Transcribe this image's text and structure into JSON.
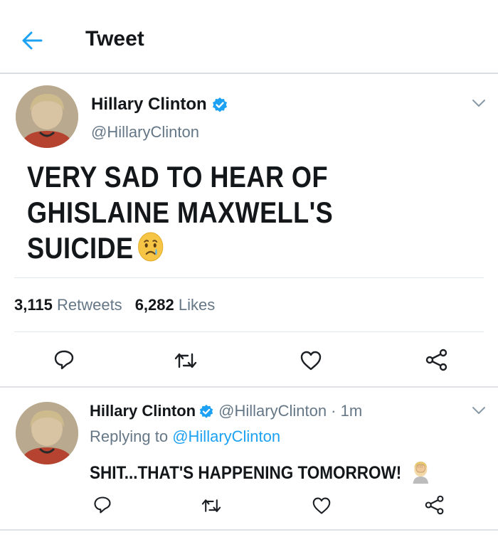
{
  "header": {
    "title": "Tweet"
  },
  "tweet": {
    "author_name": "Hillary Clinton",
    "author_handle": "@HillaryClinton",
    "text": "VERY SAD TO HEAR OF GHISLAINE MAXWELL'S SUICIDE",
    "retweet_count": "3,115",
    "retweet_label": "Retweets",
    "like_count": "6,282",
    "like_label": "Likes"
  },
  "reply": {
    "author_name": "Hillary Clinton",
    "author_handle_time": "@HillaryClinton · 1m",
    "replying_prefix": "Replying to",
    "replying_handle": "@HillaryClinton",
    "text": "SHIT...THAT'S HAPPENING TOMORROW!"
  },
  "icons": {
    "back": "arrow-left-icon",
    "verified": "verified-badge-icon",
    "more": "chevron-down-icon",
    "reply": "reply-icon",
    "retweet": "retweet-icon",
    "like": "heart-icon",
    "share": "share-icon",
    "crying_emoji": "crying-face-emoji",
    "facepalm_emoji": "facepalm-emoji"
  },
  "colors": {
    "accent": "#1da1f2",
    "text_primary": "#14171a",
    "text_secondary": "#657786",
    "divider": "#e1e8ed"
  }
}
